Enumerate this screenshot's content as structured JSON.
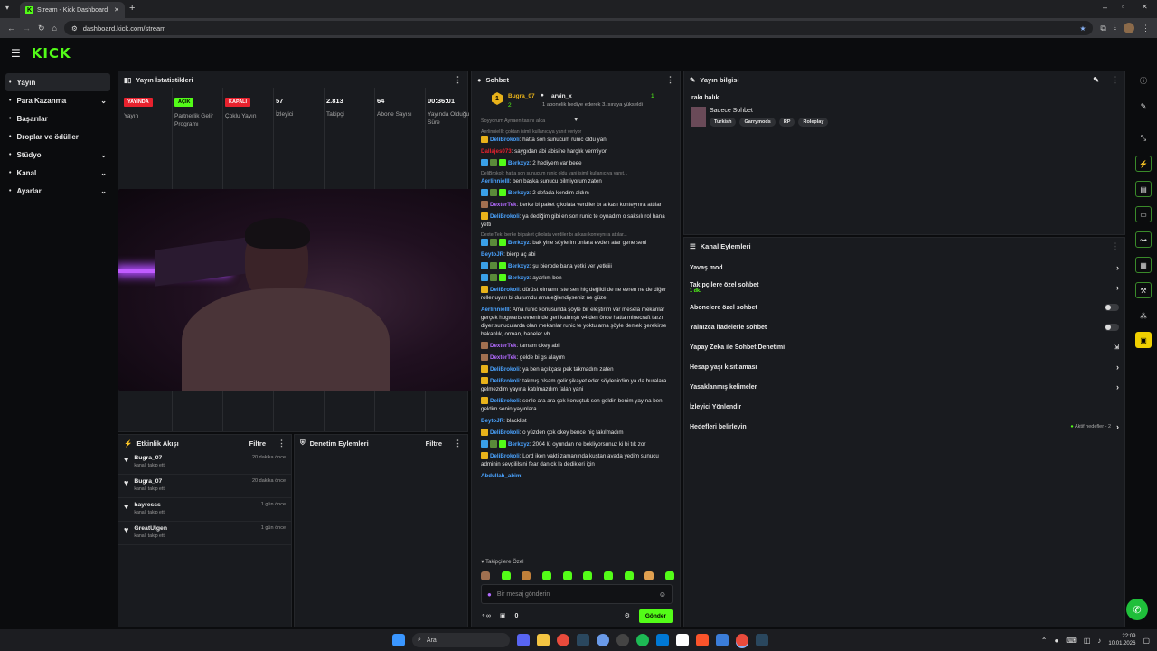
{
  "browser": {
    "tab_title": "Stream - Kick Dashboard",
    "url": "dashboard.kick.com/stream"
  },
  "header": {
    "logo": "KICK"
  },
  "sidebar": {
    "items": [
      {
        "label": "Yayın",
        "icon": "broadcast-icon",
        "chevron": false,
        "active": true
      },
      {
        "label": "Para Kazanma",
        "icon": "dollar-icon",
        "chevron": true
      },
      {
        "label": "Başarılar",
        "icon": "trophy-icon",
        "chevron": false
      },
      {
        "label": "Droplar ve ödüller",
        "icon": "gift-icon",
        "chevron": false
      },
      {
        "label": "Stüdyo",
        "icon": "studio-icon",
        "chevron": true
      },
      {
        "label": "Kanal",
        "icon": "channel-icon",
        "chevron": true
      },
      {
        "label": "Ayarlar",
        "icon": "gear-icon",
        "chevron": true
      }
    ]
  },
  "stats": {
    "title": "Yayın İstatistikleri",
    "columns": [
      {
        "badge": "YAYINDA",
        "badge_color": "#e8222e",
        "label": "Yayın"
      },
      {
        "badge": "AÇIK",
        "badge_color": "#53fc18",
        "label": "Partnerlik Gelir Programı"
      },
      {
        "badge": "KAPALI",
        "badge_color": "#e8222e",
        "label": "Çoklu Yayın"
      },
      {
        "value": "57",
        "label": "İzleyici"
      },
      {
        "value": "2.813",
        "label": "Takipçi"
      },
      {
        "value": "64",
        "label": "Abone Sayısı"
      },
      {
        "value": "00:36:01",
        "label": "Yayında Olduğu Süre"
      }
    ]
  },
  "activity": {
    "title": "Etkinlik Akışı",
    "filter": "Filtre",
    "events": [
      {
        "name": "Bugra_07",
        "sub": "kanalı takip etti",
        "time": "20 dakika önce"
      },
      {
        "name": "Bugra_07",
        "sub": "kanalı takip etti",
        "time": "20 dakika önce"
      },
      {
        "name": "hayresss",
        "sub": "kanalı takip etti",
        "time": "1 gün önce"
      },
      {
        "name": "GreatUlgen",
        "sub": "kanalı takip etti",
        "time": "1 gün önce"
      }
    ]
  },
  "moderation": {
    "title": "Denetim Eylemleri",
    "filter": "Filtre"
  },
  "chat": {
    "title": "Sohbet",
    "pinned": {
      "rank": "1",
      "user": "Bugra_07",
      "gifts": "2",
      "target": "arvin_x",
      "count": "1",
      "note": "1 abonelik hediye ederek 3. sıraya yükseldi"
    },
    "cut_line": "Soyyorum Aynaen tasını alca",
    "messages": [
      {
        "reply": "AerlinnieIII: çoktan isimli kullanıcıya yanıt veriyor",
        "user": "DeliBrokoli",
        "color": "#4aa3ff",
        "text": ": hatta son sunucum runic oldu yani",
        "icons": [
          "#e8b21a"
        ]
      },
      {
        "user": "Dallajes073",
        "color": "#e8222e",
        "text": ": saygıdan abi abisine harçlık vermiyor",
        "icons": []
      },
      {
        "user": "Berkxyz",
        "color": "#4aa3ff",
        "text": ": 2 hediyem var beee",
        "icons": [
          "#3aa0e8",
          "#5a8a3a",
          "#53fc18"
        ]
      },
      {
        "reply": "DeliBrokoli: hatta son sunucum runic oldu yani isimli kullanıcıya yanıt...",
        "user": "AerlinnieIII",
        "color": "#4aa3ff",
        "text": ": ben başka sunucu bilmiyorum zaten",
        "icons": []
      },
      {
        "user": "Berkxyz",
        "color": "#4aa3ff",
        "text": ": 2 defada kendim aldım",
        "icons": [
          "#3aa0e8",
          "#5a8a3a",
          "#53fc18"
        ]
      },
      {
        "user": "DexterTek",
        "color": "#b36bff",
        "text": ": berke bi paket çikolata verdiler bı arkası konteynıra attılar",
        "icons": [
          "#a07050"
        ]
      },
      {
        "user": "DeliBrokoli",
        "color": "#4aa3ff",
        "text": ": ya dediğim gibi en son runic te oynadım o saksılı rol bana yetti",
        "icons": [
          "#e8b21a"
        ]
      },
      {
        "reply": "DexterTek: berke bi paket çikolata verdiler bı arkası konteynıra attılar...",
        "user": "Berkxyz",
        "color": "#4aa3ff",
        "text": ": bak yine söylerim onlara evden atar gene seni",
        "icons": [
          "#3aa0e8",
          "#5a8a3a",
          "#53fc18"
        ]
      },
      {
        "user": "BeytoJR",
        "color": "#4aa3ff",
        "text": ": bierp aç abi",
        "icons": []
      },
      {
        "user": "Berkxyz",
        "color": "#4aa3ff",
        "text": ": şu bierpde bana yetki ver yetkiiii",
        "icons": [
          "#3aa0e8",
          "#5a8a3a",
          "#53fc18"
        ]
      },
      {
        "user": "Berkxyz",
        "color": "#4aa3ff",
        "text": ": ayarlım ben",
        "icons": [
          "#3aa0e8",
          "#5a8a3a",
          "#53fc18"
        ]
      },
      {
        "user": "DeliBrokoli",
        "color": "#4aa3ff",
        "text": ": dürüst olmamı istersen hiç değildi de ne evren ne de diğer roller uyarı bi durumdu ama eğlendiyseniz ne güzel",
        "icons": [
          "#e8b21a"
        ]
      },
      {
        "user": "AerlinnieIII",
        "color": "#4aa3ff",
        "text": ": Ama runic konusunda şöyle bir eleştirim var mesela mekanlar gerçek hogwarts evreninde geri kalmıştı v4 den önce hatta minecraft tarzı diyer sunucularda olan mekanlar runic te yoktu ama şöyle demek gerekirse bakanlık, orman, haneler vb",
        "icons": []
      },
      {
        "user": "DexterTek",
        "color": "#b36bff",
        "text": ": tamam okey abi",
        "icons": [
          "#a07050"
        ]
      },
      {
        "user": "DexterTek",
        "color": "#b36bff",
        "text": ": gelde bi gs alayım",
        "icons": [
          "#a07050"
        ]
      },
      {
        "user": "DeliBrokoli",
        "color": "#4aa3ff",
        "text": ": ya ben açıkçası pek takmadım zaten",
        "icons": [
          "#e8b21a"
        ]
      },
      {
        "user": "DeliBrokoli",
        "color": "#4aa3ff",
        "text": ": takmış olsam gelir şikayet eder söylenirdim ya da buralara gelmezdim yayına katılmazdım falan yani",
        "icons": [
          "#e8b21a"
        ]
      },
      {
        "user": "DeliBrokoli",
        "color": "#4aa3ff",
        "text": ": senle ara ara çok konuştuk sen geldin benim yayına ben geldim senin yayınlara",
        "icons": [
          "#e8b21a"
        ]
      },
      {
        "user": "BeytoJR",
        "color": "#4aa3ff",
        "text": ": blacklist",
        "icons": []
      },
      {
        "user": "DeliBrokoli",
        "color": "#4aa3ff",
        "text": ": o yüzden çok okey bence hiç takılmadım",
        "icons": [
          "#e8b21a"
        ]
      },
      {
        "user": "Berkxyz",
        "color": "#4aa3ff",
        "text": ": 2004 lü oyundan ne bekliyorsunuz ki bi tık zor",
        "icons": [
          "#3aa0e8",
          "#5a8a3a",
          "#53fc18"
        ]
      },
      {
        "user": "DeliBrokoli",
        "color": "#4aa3ff",
        "text": ": Lord iken vakti zamanında kuştan avada yedim sunucu adminin sevgililsini fear dan ck la dedikleri için",
        "icons": [
          "#e8b21a"
        ]
      },
      {
        "user": "Abdullah_abim",
        "color": "#4aa3ff",
        "text": ":",
        "icons": []
      }
    ],
    "followers_only": "Takipçilere Özel",
    "input_placeholder": "Bir mesaj gönderin",
    "points": "0",
    "send": "Gönder"
  },
  "stream_info": {
    "title": "Yayın bilgisi",
    "stream_title": "rakı balık",
    "category": "Sadece Sohbet",
    "tags": [
      "Turkish",
      "Garrymods",
      "RP",
      "Roleplay"
    ]
  },
  "channel_actions": {
    "title": "Kanal Eylemleri",
    "rows": [
      {
        "label": "Yavaş mod",
        "kind": "chevron"
      },
      {
        "label": "Takipçilere özel sohbet",
        "kind": "chevron",
        "sub": "1 dk."
      },
      {
        "label": "Abonelere özel sohbet",
        "kind": "toggle"
      },
      {
        "label": "Yalnızca ifadelerle sohbet",
        "kind": "toggle"
      },
      {
        "label": "Yapay Zeka ile Sohbet Denetimi",
        "kind": "external"
      },
      {
        "label": "Hesap yaşı kısıtlaması",
        "kind": "chevron"
      },
      {
        "label": "Yasaklanmış kelimeler",
        "kind": "chevron"
      },
      {
        "label": "İzleyici Yönlendir",
        "kind": "none"
      },
      {
        "label": "Hedefleri belirleyin",
        "kind": "chevron",
        "extra": "Aktif hedefler - 2"
      }
    ]
  },
  "taskbar": {
    "search": "Ara",
    "time": "22:09",
    "date": "10.01.2026"
  },
  "colors": {
    "accent": "#53fc18",
    "panel": "#191b1f",
    "bg": "#0b0c0e"
  }
}
